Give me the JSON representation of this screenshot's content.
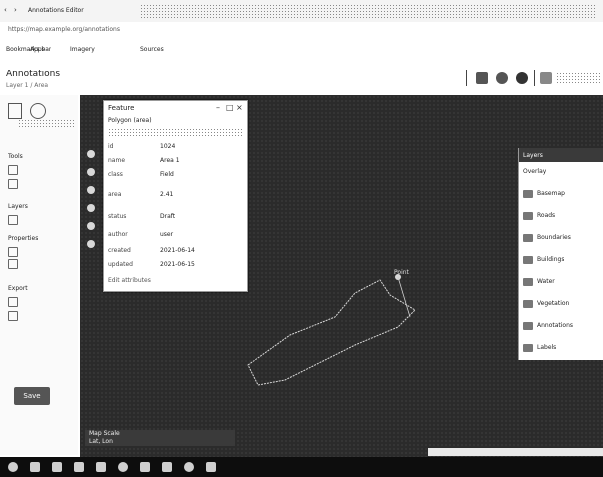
{
  "browser": {
    "tab_title": "Annotations Editor",
    "address": "https://map.example.org/annotations"
  },
  "bookmarks": {
    "label": "Bookmarks bar",
    "items": [
      "Apps",
      "Imagery",
      "Sources"
    ]
  },
  "app": {
    "title": "Annotations",
    "subtitle": "Layer 1 / Area"
  },
  "left_panel": {
    "sections": [
      "Tools",
      "Layers",
      "Properties",
      "Export"
    ],
    "button_label": "Save"
  },
  "popup": {
    "title": "Feature",
    "header_line": "Polygon (area)",
    "rows": [
      {
        "key": "id",
        "value": "1024"
      },
      {
        "key": "name",
        "value": "Area 1"
      },
      {
        "key": "class",
        "value": "Field"
      },
      {
        "key": "area",
        "value": "2.41"
      },
      {
        "key": "status",
        "value": "Draft"
      },
      {
        "key": "author",
        "value": "user"
      },
      {
        "key": "created",
        "value": "2021-06-14"
      },
      {
        "key": "updated",
        "value": "2021-06-15"
      }
    ],
    "footer": "Edit attributes"
  },
  "map": {
    "point_label": "Point"
  },
  "layer_panel": {
    "title": "Layers",
    "subtitle": "Overlay",
    "items": [
      "Basemap",
      "Roads",
      "Boundaries",
      "Buildings",
      "Water",
      "Vegetation",
      "Annotations",
      "Labels"
    ]
  },
  "status": {
    "line1": "Map Scale",
    "line2": "Lat, Lon"
  },
  "colors": {
    "map_bg": "#2b2b2b",
    "polygon": "#d9d9d9",
    "taskbar": "#0d0d0d"
  }
}
